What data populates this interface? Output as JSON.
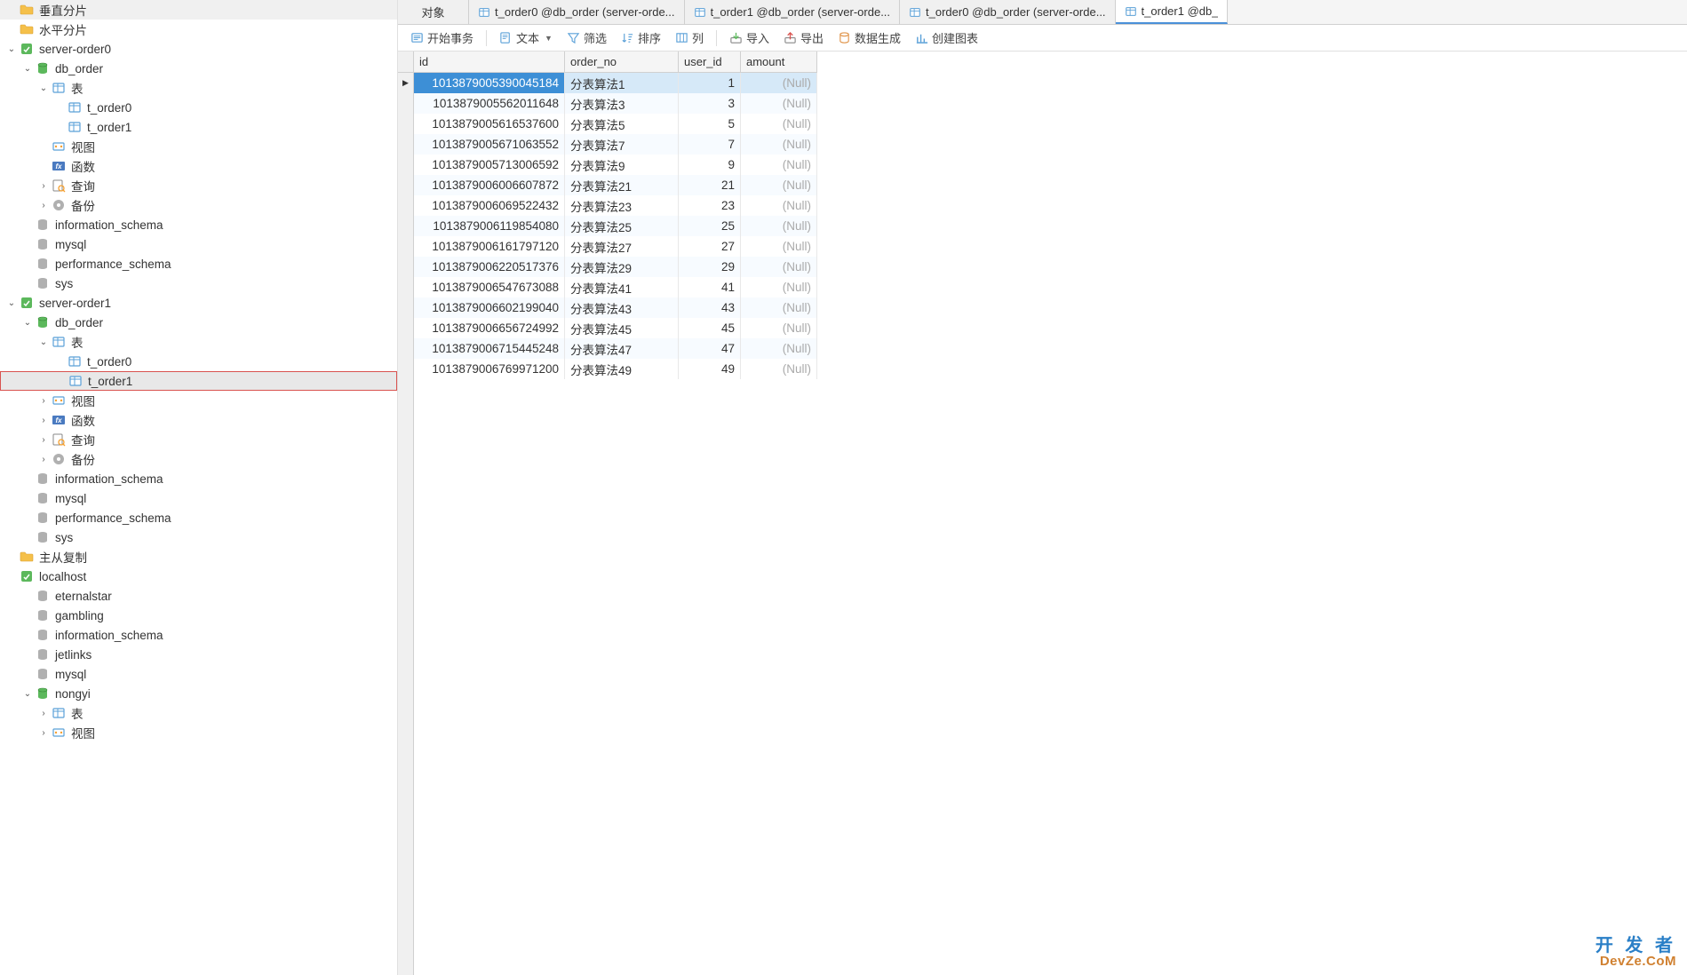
{
  "tabs": [
    {
      "label": "对象",
      "type": "obj"
    },
    {
      "label": "t_order0 @db_order (server-orde...",
      "icon": "table"
    },
    {
      "label": "t_order1 @db_order (server-orde...",
      "icon": "table"
    },
    {
      "label": "t_order0 @db_order (server-orde...",
      "icon": "table"
    },
    {
      "label": "t_order1 @db_",
      "icon": "table",
      "active": true
    }
  ],
  "toolbar": {
    "begin": "开始事务",
    "text": "文本",
    "filter": "筛选",
    "sort": "排序",
    "col": "列",
    "import": "导入",
    "export": "导出",
    "gen": "数据生成",
    "chart": "创建图表"
  },
  "columns": {
    "id": "id",
    "order_no": "order_no",
    "user_id": "user_id",
    "amount": "amount"
  },
  "null_text": "(Null)",
  "rows": [
    {
      "id": "1013879005390045184",
      "on": "分表算法1",
      "uid": "1",
      "sel": true
    },
    {
      "id": "1013879005562011648",
      "on": "分表算法3",
      "uid": "3"
    },
    {
      "id": "1013879005616537600",
      "on": "分表算法5",
      "uid": "5"
    },
    {
      "id": "1013879005671063552",
      "on": "分表算法7",
      "uid": "7"
    },
    {
      "id": "1013879005713006592",
      "on": "分表算法9",
      "uid": "9"
    },
    {
      "id": "1013879006006607872",
      "on": "分表算法21",
      "uid": "21"
    },
    {
      "id": "1013879006069522432",
      "on": "分表算法23",
      "uid": "23"
    },
    {
      "id": "1013879006119854080",
      "on": "分表算法25",
      "uid": "25"
    },
    {
      "id": "1013879006161797120",
      "on": "分表算法27",
      "uid": "27"
    },
    {
      "id": "1013879006220517376",
      "on": "分表算法29",
      "uid": "29"
    },
    {
      "id": "1013879006547673088",
      "on": "分表算法41",
      "uid": "41"
    },
    {
      "id": "1013879006602199040",
      "on": "分表算法43",
      "uid": "43"
    },
    {
      "id": "1013879006656724992",
      "on": "分表算法45",
      "uid": "45"
    },
    {
      "id": "1013879006715445248",
      "on": "分表算法47",
      "uid": "47"
    },
    {
      "id": "1013879006769971200",
      "on": "分表算法49",
      "uid": "49"
    }
  ],
  "tree": [
    {
      "d": 0,
      "ch": "",
      "ic": "folder-y",
      "t": "垂直分片"
    },
    {
      "d": 0,
      "ch": "",
      "ic": "folder-y",
      "t": "水平分片"
    },
    {
      "d": 0,
      "ch": "v",
      "ic": "conn-g",
      "t": "server-order0"
    },
    {
      "d": 1,
      "ch": "v",
      "ic": "db-g",
      "t": "db_order"
    },
    {
      "d": 2,
      "ch": "v",
      "ic": "table",
      "t": "表"
    },
    {
      "d": 3,
      "ch": "",
      "ic": "table",
      "t": "t_order0"
    },
    {
      "d": 3,
      "ch": "",
      "ic": "table",
      "t": "t_order1"
    },
    {
      "d": 2,
      "ch": "",
      "ic": "view",
      "t": "视图"
    },
    {
      "d": 2,
      "ch": "",
      "ic": "fx",
      "t": "函数"
    },
    {
      "d": 2,
      "ch": ">",
      "ic": "query",
      "t": "查询"
    },
    {
      "d": 2,
      "ch": ">",
      "ic": "backup",
      "t": "备份"
    },
    {
      "d": 1,
      "ch": "",
      "ic": "db",
      "t": "information_schema"
    },
    {
      "d": 1,
      "ch": "",
      "ic": "db",
      "t": "mysql"
    },
    {
      "d": 1,
      "ch": "",
      "ic": "db",
      "t": "performance_schema"
    },
    {
      "d": 1,
      "ch": "",
      "ic": "db",
      "t": "sys"
    },
    {
      "d": 0,
      "ch": "v",
      "ic": "conn-g",
      "t": "server-order1"
    },
    {
      "d": 1,
      "ch": "v",
      "ic": "db-g",
      "t": "db_order"
    },
    {
      "d": 2,
      "ch": "v",
      "ic": "table",
      "t": "表"
    },
    {
      "d": 3,
      "ch": "",
      "ic": "table",
      "t": "t_order0"
    },
    {
      "d": 3,
      "ch": "",
      "ic": "table",
      "t": "t_order1",
      "hl": true
    },
    {
      "d": 2,
      "ch": ">",
      "ic": "view",
      "t": "视图"
    },
    {
      "d": 2,
      "ch": ">",
      "ic": "fx",
      "t": "函数"
    },
    {
      "d": 2,
      "ch": ">",
      "ic": "query",
      "t": "查询"
    },
    {
      "d": 2,
      "ch": ">",
      "ic": "backup",
      "t": "备份"
    },
    {
      "d": 1,
      "ch": "",
      "ic": "db",
      "t": "information_schema"
    },
    {
      "d": 1,
      "ch": "",
      "ic": "db",
      "t": "mysql"
    },
    {
      "d": 1,
      "ch": "",
      "ic": "db",
      "t": "performance_schema"
    },
    {
      "d": 1,
      "ch": "",
      "ic": "db",
      "t": "sys"
    },
    {
      "d": 0,
      "ch": "",
      "ic": "folder-y",
      "t": "主从复制"
    },
    {
      "d": 0,
      "ch": "",
      "ic": "conn-g",
      "t": "localhost"
    },
    {
      "d": 1,
      "ch": "",
      "ic": "db",
      "t": "eternalstar"
    },
    {
      "d": 1,
      "ch": "",
      "ic": "db",
      "t": "gambling"
    },
    {
      "d": 1,
      "ch": "",
      "ic": "db",
      "t": "information_schema"
    },
    {
      "d": 1,
      "ch": "",
      "ic": "db",
      "t": "jetlinks"
    },
    {
      "d": 1,
      "ch": "",
      "ic": "db",
      "t": "mysql"
    },
    {
      "d": 1,
      "ch": "v",
      "ic": "db-g",
      "t": "nongyi"
    },
    {
      "d": 2,
      "ch": ">",
      "ic": "table",
      "t": "表"
    },
    {
      "d": 2,
      "ch": ">",
      "ic": "view",
      "t": "视图"
    }
  ],
  "watermark": {
    "l1": "开 发 者",
    "l2": "DevZe.CoM"
  }
}
